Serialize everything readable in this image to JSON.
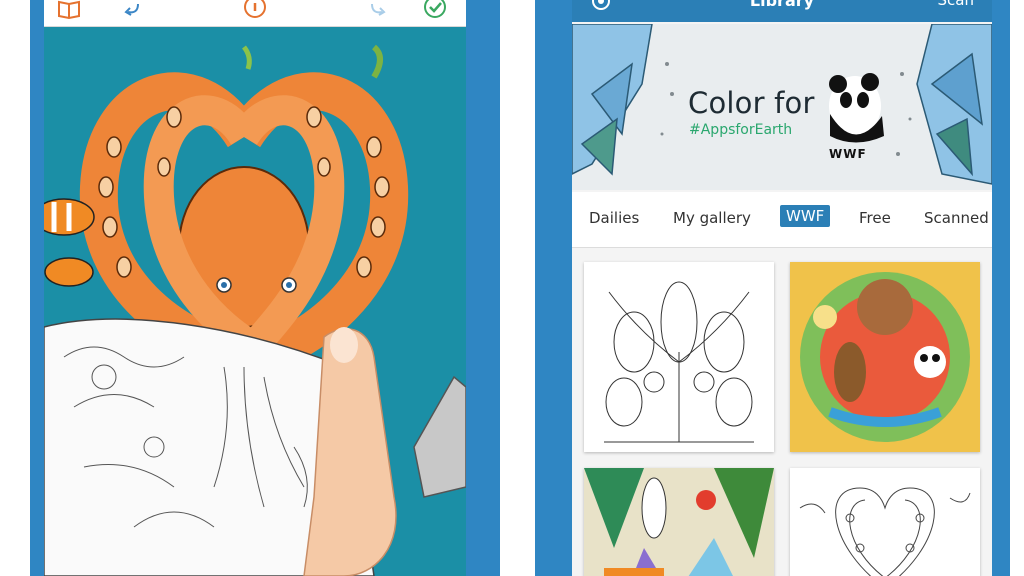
{
  "left_app": {
    "toolbar": {
      "icons": [
        "book-icon",
        "undo-icon",
        "info-icon",
        "redo-icon",
        "done-icon"
      ]
    },
    "canvas": {
      "subject": "octopus"
    }
  },
  "right_app": {
    "navbar": {
      "title": "Library",
      "action_label": "Scan"
    },
    "banner": {
      "title": "Color for",
      "hashtag": "#AppsforEarth",
      "logo_text": "WWF"
    },
    "tabs": [
      {
        "label": "Dailies",
        "active": false
      },
      {
        "label": "My gallery",
        "active": false
      },
      {
        "label": "WWF",
        "active": true
      },
      {
        "label": "Free",
        "active": false
      },
      {
        "label": "Scanned",
        "active": false
      }
    ]
  },
  "colors": {
    "frame_blue": "#2f86c3",
    "nav_blue": "#2b7fb6",
    "ocean_teal": "#1b8fa6",
    "octopus_orange": "#ee8538",
    "icon_orange": "#e5722f",
    "icon_green": "#3aa860"
  }
}
